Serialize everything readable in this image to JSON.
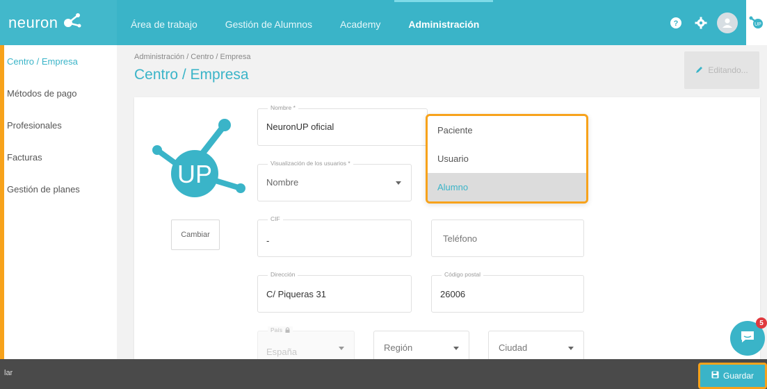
{
  "brand": {
    "name": "neuron",
    "badge": "UP"
  },
  "nav": {
    "items": [
      {
        "label": "Área de trabajo",
        "active": false
      },
      {
        "label": "Gestión de Alumnos",
        "active": false
      },
      {
        "label": "Academy",
        "active": false
      },
      {
        "label": "Administración",
        "active": true
      }
    ]
  },
  "top_icons": [
    "help-icon",
    "gear-icon",
    "avatar",
    "up-logo"
  ],
  "sidebar": {
    "items": [
      {
        "label": "Centro / Empresa",
        "active": true
      },
      {
        "label": "Métodos de pago",
        "active": false
      },
      {
        "label": "Profesionales",
        "active": false
      },
      {
        "label": "Facturas",
        "active": false
      },
      {
        "label": "Gestión de planes",
        "active": false
      }
    ]
  },
  "header": {
    "breadcrumb": "Administración / Centro / Empresa",
    "title": "Centro / Empresa",
    "editing_label": "Editando..."
  },
  "form": {
    "logo_text": "UP",
    "change_label": "Cambiar",
    "nombre": {
      "label": "Nombre *",
      "value": "NeuronUP oficial"
    },
    "visualizacion": {
      "label": "Visualización de los usuarios *",
      "value": "Nombre"
    },
    "cif": {
      "label": "CIF",
      "value": "-"
    },
    "telefono": {
      "placeholder": "Teléfono"
    },
    "direccion": {
      "label": "Dirección",
      "value": "C/ Piqueras 31"
    },
    "codigo_postal": {
      "label": "Código postal",
      "value": "26006"
    },
    "pais": {
      "label": "País",
      "value": "España"
    },
    "region": {
      "placeholder": "Región"
    },
    "ciudad": {
      "placeholder": "Ciudad"
    }
  },
  "dropdown": {
    "options": [
      {
        "label": "Paciente",
        "selected": false
      },
      {
        "label": "Usuario",
        "selected": false
      },
      {
        "label": "Alumno",
        "selected": true
      }
    ]
  },
  "bottom": {
    "left_text": "lar",
    "save_label": "Guardar"
  },
  "chat": {
    "badge_count": "5"
  },
  "colors": {
    "accent": "#3ab4c8",
    "highlight": "#f7a21b",
    "bottom_bar": "#4a4a4a"
  }
}
